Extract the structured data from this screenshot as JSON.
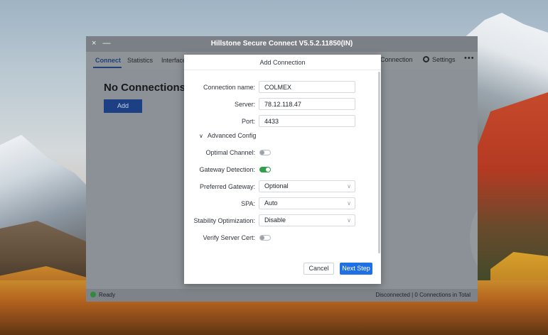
{
  "app": {
    "title": "Hillstone Secure Connect V5.5.2.11850(IN)",
    "window_controls": "× —",
    "tabs": [
      {
        "label": "Connect",
        "active": true
      },
      {
        "label": "Statistics",
        "active": false
      },
      {
        "label": "Interface",
        "active": false
      }
    ],
    "toolbar": {
      "connection_label": "Connection",
      "settings_label": "Settings",
      "more_label": "•••"
    },
    "main": {
      "heading": "No Connections A",
      "add_button": "Add"
    },
    "status": {
      "ready": "Ready",
      "right": "Disconnected | 0 Connections in Total"
    }
  },
  "dialog": {
    "title": "Add Connection",
    "fields": {
      "connection_name": {
        "label": "Connection name:",
        "value": "COLMEX"
      },
      "server": {
        "label": "Server:",
        "value": "78.12.118.47"
      },
      "port": {
        "label": "Port:",
        "value": "4433"
      }
    },
    "advanced_label": "Advanced Config",
    "toggles": {
      "optimal_channel": {
        "label": "Optimal Channel:",
        "on": false
      },
      "gateway_detection": {
        "label": "Gateway Detection:",
        "on": true
      },
      "verify_server_cert": {
        "label": "Verify Server Cert:",
        "on": false
      }
    },
    "selects": {
      "preferred_gateway": {
        "label": "Preferred Gateway:",
        "value": "Optional"
      },
      "spa": {
        "label": "SPA:",
        "value": "Auto"
      },
      "stability_optimization": {
        "label": "Stability Optimization:",
        "value": "Disable"
      }
    },
    "buttons": {
      "cancel": "Cancel",
      "next": "Next Step"
    }
  },
  "colors": {
    "accent": "#1f6fe5",
    "toggle_on": "#2ea04a",
    "status_ready": "#2e8b3b"
  }
}
